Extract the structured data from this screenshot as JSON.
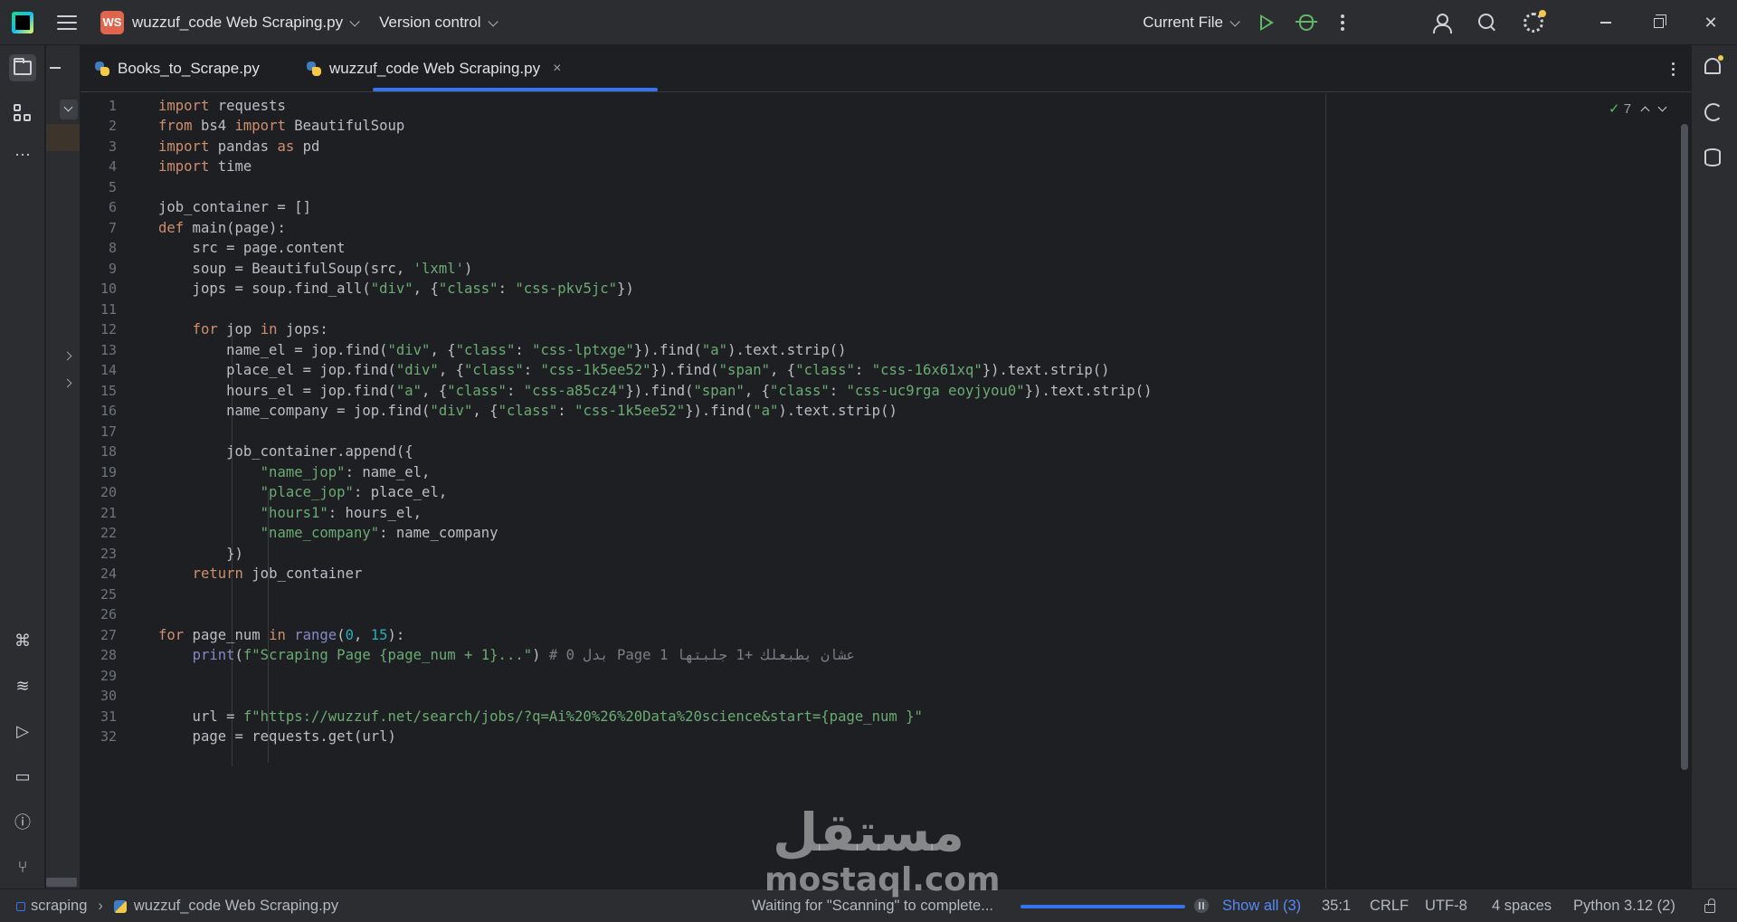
{
  "titlebar": {
    "project_badge": "WS",
    "project_name": "wuzzuf_code Web Scraping.py",
    "version_control": "Version control",
    "run_config": "Current File"
  },
  "tabs": [
    {
      "label": "Books_to_Scrape.py"
    },
    {
      "label": "wuzzuf_code Web Scraping.py"
    }
  ],
  "tab_close": "×",
  "inspections": {
    "count": "7"
  },
  "code_lines": [
    "import requests",
    "from bs4 import BeautifulSoup",
    "import pandas as pd",
    "import time",
    "",
    "job_container = []",
    "def main(page):",
    "    src = page.content",
    "    soup = BeautifulSoup(src, 'lxml')",
    "    jops = soup.find_all(\"div\", {\"class\": \"css-pkv5jc\"})",
    "",
    "    for jop in jops:",
    "        name_el = jop.find(\"div\", {\"class\": \"css-lptxge\"}).find(\"a\").text.strip()",
    "        place_el = jop.find(\"div\", {\"class\": \"css-1k5ee52\"}).find(\"span\", {\"class\": \"css-16x61xq\"}).text.strip()",
    "        hours_el = jop.find(\"a\", {\"class\": \"css-a85cz4\"}).find(\"span\", {\"class\": \"css-uc9rga eoyjyou0\"}).text.strip()",
    "        name_company = jop.find(\"div\", {\"class\": \"css-1k5ee52\"}).find(\"a\").text.strip()",
    "",
    "        job_container.append({",
    "            \"name_jop\": name_el,",
    "            \"place_jop\": place_el,",
    "            \"hours1\": hours_el,",
    "            \"name_company\": name_company",
    "        })",
    "    return job_container",
    "",
    "",
    "for page_num in range(0, 15):",
    "    print(f\"Scraping Page {page_num + 1}...\") # 0 بدل Page 1 عشان يطبعلك +1 جلبتها",
    "",
    "",
    "    url = f\"https://wuzzuf.net/search/jobs/?q=Ai%20%26%20Data%20science&start={page_num }\"",
    "    page = requests.get(url)"
  ],
  "status": {
    "project": "scraping",
    "file": "wuzzuf_code Web Scraping.py",
    "task": "Waiting for \"Scanning\" to complete...",
    "show_all": "Show all (3)",
    "position": "35:1",
    "line_sep": "CRLF",
    "encoding": "UTF-8",
    "indent": "4 spaces",
    "interpreter": "Python 3.12 (2)"
  },
  "watermark": {
    "arabic": "مستقل",
    "latin": "mostaql.com"
  },
  "colors": {
    "accent": "#3574f0",
    "keyword": "#cf8e6d",
    "string": "#6aab73",
    "number": "#2aacb8",
    "run": "#5fb865"
  },
  "progress": {
    "fraction": 1.0
  }
}
